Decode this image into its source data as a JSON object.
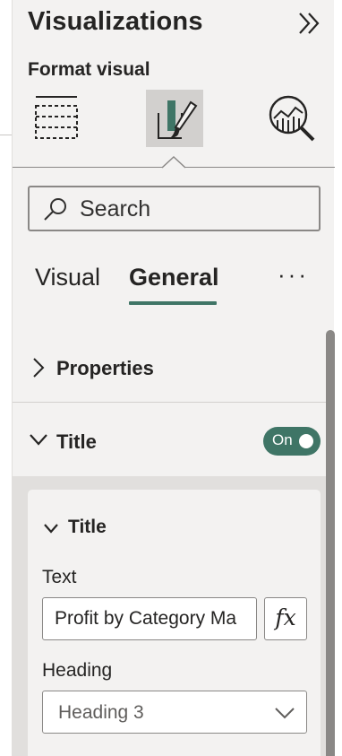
{
  "pane": {
    "title": "Visualizations",
    "section_label": "Format visual"
  },
  "viz_tabs": [
    {
      "name": "build-visual",
      "icon": "build-visual-icon",
      "selected": false
    },
    {
      "name": "format-visual",
      "icon": "format-paintbrush-icon",
      "selected": true
    },
    {
      "name": "analytics",
      "icon": "analytics-magnifier-icon",
      "selected": false
    }
  ],
  "search": {
    "placeholder": "Search",
    "value": ""
  },
  "sub_tabs": {
    "visual": "Visual",
    "general": "General",
    "active": "General",
    "more": "···"
  },
  "sections": {
    "properties": "Properties",
    "title": "Title",
    "title_toggle": "On"
  },
  "title_card": {
    "header": "Title",
    "text_label": "Text",
    "text_value": "Profit by Category Ma",
    "fx_label": "fx",
    "heading_label": "Heading",
    "heading_value": "Heading 3"
  },
  "colors": {
    "accent": "#3f7566",
    "pane_bg": "#f3f2f1",
    "selected_tab_bg": "#d2d0ce",
    "sub_area_bg": "#e1dfdd"
  }
}
